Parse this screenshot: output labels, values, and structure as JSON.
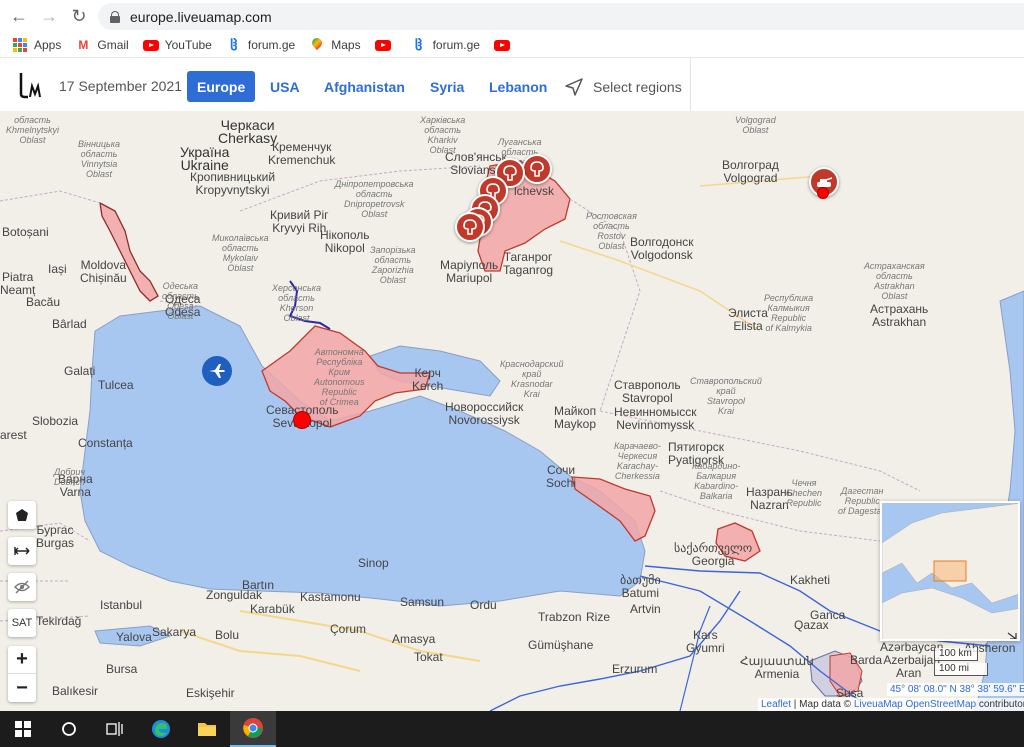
{
  "browser": {
    "url": "europe.liveuamap.com",
    "bookmarks": [
      {
        "label": "Apps",
        "icon": "apps-grid-icon"
      },
      {
        "label": "Gmail",
        "icon": "gmail-icon"
      },
      {
        "label": "YouTube",
        "icon": "youtube-icon"
      },
      {
        "label": "forum.ge",
        "icon": "forum-ge-icon"
      },
      {
        "label": "Maps",
        "icon": "maps-pin-icon"
      },
      {
        "label": "",
        "icon": "youtube-icon"
      },
      {
        "label": "forum.ge",
        "icon": "forum-ge-icon"
      },
      {
        "label": "",
        "icon": "youtube-icon"
      }
    ]
  },
  "header": {
    "date": "17 September 2021",
    "tabs": [
      {
        "label": "Europe",
        "active": true
      },
      {
        "label": "USA",
        "active": false
      },
      {
        "label": "Afghanistan",
        "active": false
      },
      {
        "label": "Syria",
        "active": false
      },
      {
        "label": "Lebanon",
        "active": false
      }
    ],
    "select_regions": "Select regions"
  },
  "colors": {
    "accent": "#2f6dd6",
    "sea": "#a8c7f0",
    "land": "#f2efe9",
    "occupied_fill": "#f2a6a6",
    "occupied_stroke": "#c0392b",
    "marker": "#c0392b"
  },
  "map": {
    "labels": {
      "cherkasy": "Черкаси\nCherkasy",
      "ukraine": "Україна\nUkraine",
      "kremenchuk": "Кременчук\nKremenchuk",
      "kropyvnytskyi": "Кропивницький\nKropyvnytskyi",
      "kryvyi_rih": "Кривий Ріг\nKryvyi Rih",
      "nikopol": "Нікополь\nNikopol",
      "moldova": "Moldova\nChișinău",
      "odesa": "Одеса\nOdesa",
      "galati": "Galați",
      "tulcea": "Tulcea",
      "constanta": "Constanța",
      "bucharest": "arest",
      "sevastopol": "Севастополь\nSevastopol",
      "kerch": "Керч\nKerch",
      "mariupol": "Маріуполь\nMariupol",
      "taganrog": "Таганрог\nTaganrog",
      "sloviansk": "Слов'янськ\nSloviansk",
      "luhansk": "lchevsk",
      "rostov_oblast": "Ростовская\nобласть\nRostov\nOblast",
      "volgodonsk": "Волгодонск\nVolgodonsk",
      "volgograd": "Волгоград\nVolgograd",
      "elista": "Элиста\nElista",
      "kalmykia": "Республика\nКалмыкия\nRepublic\nof Kalmykia",
      "astrakhan_oblast": "Астраханская\nобласть\nAstrakhan\nOblast",
      "astrakhan": "Астрахань\nAstrakhan",
      "novorossiysk": "Новороссийск\nNovorossiysk",
      "krasnodar": "Краснодарский\nкрай\nKrasnodar\nKrai",
      "maykop": "Майкоп\nMaykop",
      "stavropol": "Ставрополь\nStavropol",
      "stavropol_krai": "Ставропольский\nкрай\nStavropol\nKrai",
      "nevinnomyssk": "Невинномысск\nNevinnomyssk",
      "sochi": "Сочи\nSochi",
      "karachay": "Карачаево-\nЧеркесия\nKarachay-\nCherkessia",
      "pyatigorsk": "Пятигорск\nPyatigorsk",
      "kabardino": "Кабардино-\nБалкария\nKabardino-\nBalkaria",
      "nazran": "Назрань\nNazran",
      "chechnya": "Чечня\nChechen\nRepublic",
      "dagestan": "Дагестан\nRepublic\nof Dagestan",
      "georgia": "საქართველო\nGeorgia",
      "batumi": "ბათუმი\nBatumi",
      "kutaisi": "Kakheti",
      "burgas": "Бургас\nBurgas",
      "varna": "Варна\nVarna",
      "dobrich": "Добрич\nDobrich",
      "sinop": "Sinop",
      "bartin": "Bartın",
      "zonguldak": "Zonguldak",
      "karabuk": "Karabük",
      "kastamonu": "Kastamonu",
      "samsun": "Samsun",
      "ordu": "Ordu",
      "trabzon": "Trabzon",
      "rize": "Rize",
      "artvin": "Artvin",
      "sakarya": "Sakarya",
      "bolu": "Bolu",
      "corum": "Çorum",
      "amasya": "Amasya",
      "tokat": "Tokat",
      "gumushane": "Gümüşhane",
      "erzurum": "Erzurum",
      "kars": "Kars\nGyumri",
      "armenia": "Հայաստան\nArmenia",
      "azerbaijan": "Azərbaycan\nAzerbaijan",
      "istanbul": "Istanbul",
      "tekirdag": "Tekirdağ",
      "yalova": "Yalova",
      "bursa": "Bursa",
      "balikesir": "Balıkesir",
      "eskisehir": "Eskişehir",
      "kherson": "Херсонська\nобласть\nKherson\nOblast",
      "crimea": "Автономна\nРеспубліка\nКрим\nAutonomous\nRepublic\nof Crimea",
      "dnipro": "Дніпропетровська\nобласть\nDnipropetrovsk\nOblast",
      "zaporizhia": "Запорізька\nобласть\nZaporizhia\nOblast",
      "mykolaiv": "Миколаївська\nобласть\nMykolaiv\nOblast",
      "kharkiv": "Харківська\nобласть\nKharkiv\nOblast",
      "luhansk_oblast": "Луганська\nобласть\nLuhansk\nOblast",
      "volgograd_oblast": "Volgograd\nOblast",
      "vinnytsia": "Вінницька\nобласть\nVinnytsia\nOblast",
      "khmelnytskyi": "область\nKhmelnytskyi\nOblast",
      "odesa_oblast": "Одеська\nобласть\nOdesa\nOblast",
      "botosani": "Botoșani",
      "iasi": "Iași",
      "bacau": "Bacău",
      "barlad": "Bârlad",
      "pitesti": "Piatra\nNeamț",
      "slobozia": "Slobozia",
      "susa": "Susa",
      "barda": "Barda",
      "ganja": "Ganca",
      "qazax": "Qazax",
      "aran": "Aran",
      "absheron": "Absheron"
    },
    "controls": {
      "sat_label": "SAT",
      "zoom_in": "+",
      "zoom_out": "−"
    },
    "scale": {
      "km": "100 km",
      "mi": "100 mi"
    },
    "coords": "45° 08' 08.0\" N 38° 38' 59.6\" E",
    "attribution": {
      "leaflet": "Leaflet",
      "text": " | Map data © ",
      "liveuamap": "LiveuaMap",
      "osm": " OpenStreetMap",
      "contributors": " contributors"
    }
  },
  "taskbar": {
    "items": [
      "windows-start-icon",
      "search-circle-icon",
      "task-view-icon",
      "edge-icon",
      "file-explorer-icon",
      "chrome-icon"
    ]
  }
}
